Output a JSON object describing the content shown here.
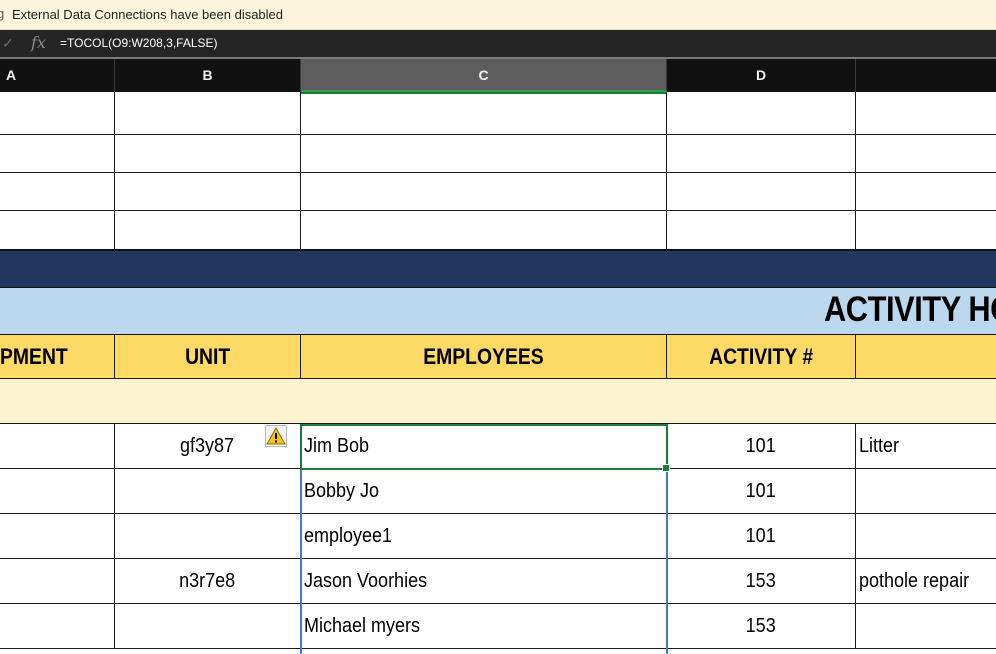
{
  "notification": {
    "glyph": "g",
    "text": "External Data Connections have been disabled"
  },
  "formula_bar": {
    "check_icon": "checkmark-icon",
    "fx_label": "fx",
    "formula": "=TOCOL(O9:W208,3,FALSE)"
  },
  "columns": [
    "A",
    "B",
    "C",
    "D",
    ""
  ],
  "selected_column": "C",
  "sheet": {
    "title": "ACTIVITY HO",
    "headers": [
      "PMENT",
      "UNIT",
      "EMPLOYEES",
      "ACTIVITY #",
      ""
    ],
    "rows": [
      {
        "unit": "gf3y87",
        "employee": "Jim Bob",
        "activity": "101",
        "description": "Litter"
      },
      {
        "unit": "",
        "employee": "Bobby Jo",
        "activity": "101",
        "description": ""
      },
      {
        "unit": "",
        "employee": "employee1",
        "activity": "101",
        "description": ""
      },
      {
        "unit": "n3r7e8",
        "employee": "Jason Voorhies",
        "activity": "153",
        "description": "pothole repair"
      },
      {
        "unit": "",
        "employee": "Michael myers",
        "activity": "153",
        "description": ""
      }
    ]
  },
  "colors": {
    "dark_band": "#22375f",
    "title_band": "#bcd8ee",
    "header_band": "#fdd966",
    "cream_band": "#fcf2cf",
    "active_cell_border": "#1e7c3a"
  }
}
